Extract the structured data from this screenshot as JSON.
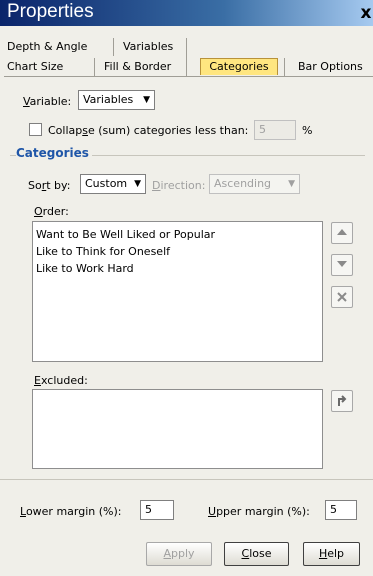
{
  "window": {
    "title": "Properties",
    "close_glyph": "x"
  },
  "tabs": {
    "row1": [
      "Depth & Angle",
      "Variables"
    ],
    "row2": [
      "Chart Size",
      "Fill & Border",
      "Categories",
      "Bar Options"
    ],
    "active": "Categories"
  },
  "variable": {
    "label_accel": "V",
    "label_rest": "ariable:",
    "value": "Variables"
  },
  "collapse": {
    "label_before": "Collap",
    "label_accel": "s",
    "label_after": "e (sum) categories less than:",
    "checked": false,
    "value": "5",
    "unit": "%"
  },
  "categories_group": {
    "title": "Categories",
    "sort_label_before": "So",
    "sort_label_accel": "r",
    "sort_label_after": "t by:",
    "sort_value": "Custom",
    "direction_label_accel": "D",
    "direction_label_rest": "irection:",
    "direction_value": "Ascending",
    "order_label_accel": "O",
    "order_label_rest": "rder:",
    "order_items": [
      "Want to Be Well Liked or Popular",
      "Like to Think for Oneself",
      "Like to Work Hard"
    ],
    "excluded_label_accel": "E",
    "excluded_label_rest": "xcluded:",
    "excluded_items": []
  },
  "margins": {
    "lower_label_accel": "L",
    "lower_label_rest": "ower margin (%):",
    "lower_value": "5",
    "upper_label_accel": "U",
    "upper_label_rest": "pper margin (%):",
    "upper_value": "5"
  },
  "buttons": {
    "apply_accel": "A",
    "apply_rest": "pply",
    "close_accel": "C",
    "close_rest": "lose",
    "help_accel": "H",
    "help_rest": "elp"
  },
  "icons": {
    "move_up": "triangle-up-icon",
    "move_down": "triangle-down-icon",
    "remove": "x-icon",
    "restore": "return-arrow-icon"
  }
}
